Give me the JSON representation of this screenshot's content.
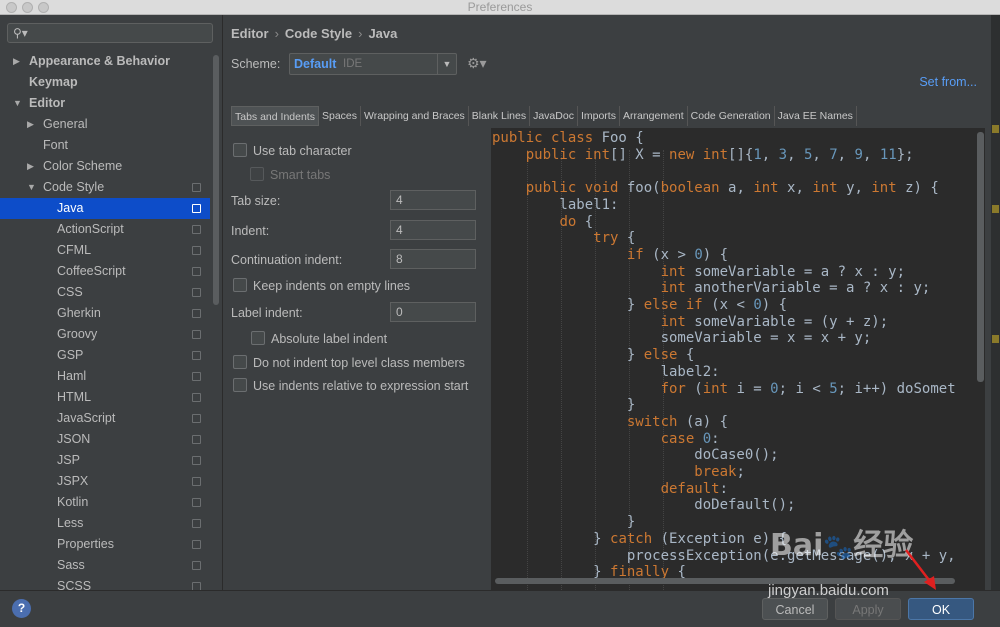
{
  "window": {
    "title": "Preferences"
  },
  "search": {
    "placeholder": ""
  },
  "sidebar": {
    "items": [
      {
        "label": "Appearance & Behavior",
        "level": 0,
        "bold": true,
        "arrow": "▶"
      },
      {
        "label": "Keymap",
        "level": 0,
        "bold": true,
        "arrow": ""
      },
      {
        "label": "Editor",
        "level": 0,
        "bold": true,
        "arrow": "▼"
      },
      {
        "label": "General",
        "level": 1,
        "arrow": "▶"
      },
      {
        "label": "Font",
        "level": 1,
        "arrow": ""
      },
      {
        "label": "Color Scheme",
        "level": 1,
        "arrow": "▶"
      },
      {
        "label": "Code Style",
        "level": 1,
        "arrow": "▼",
        "copy": true
      },
      {
        "label": "Java",
        "level": 2,
        "selected": true,
        "copy": true
      },
      {
        "label": "ActionScript",
        "level": 2,
        "copy": true
      },
      {
        "label": "CFML",
        "level": 2,
        "copy": true
      },
      {
        "label": "CoffeeScript",
        "level": 2,
        "copy": true
      },
      {
        "label": "CSS",
        "level": 2,
        "copy": true
      },
      {
        "label": "Gherkin",
        "level": 2,
        "copy": true
      },
      {
        "label": "Groovy",
        "level": 2,
        "copy": true
      },
      {
        "label": "GSP",
        "level": 2,
        "copy": true
      },
      {
        "label": "Haml",
        "level": 2,
        "copy": true
      },
      {
        "label": "HTML",
        "level": 2,
        "copy": true
      },
      {
        "label": "JavaScript",
        "level": 2,
        "copy": true
      },
      {
        "label": "JSON",
        "level": 2,
        "copy": true
      },
      {
        "label": "JSP",
        "level": 2,
        "copy": true
      },
      {
        "label": "JSPX",
        "level": 2,
        "copy": true
      },
      {
        "label": "Kotlin",
        "level": 2,
        "copy": true
      },
      {
        "label": "Less",
        "level": 2,
        "copy": true
      },
      {
        "label": "Properties",
        "level": 2,
        "copy": true
      },
      {
        "label": "Sass",
        "level": 2,
        "copy": true
      },
      {
        "label": "SCSS",
        "level": 2,
        "copy": true
      }
    ]
  },
  "breadcrumb": [
    "Editor",
    "Code Style",
    "Java"
  ],
  "scheme": {
    "label": "Scheme:",
    "value": "Default",
    "sub": "IDE"
  },
  "set_from": "Set from...",
  "tabs": [
    "Tabs and Indents",
    "Spaces",
    "Wrapping and Braces",
    "Blank Lines",
    "JavaDoc",
    "Imports",
    "Arrangement",
    "Code Generation",
    "Java EE Names"
  ],
  "options": {
    "use_tab_character": "Use tab character",
    "smart_tabs": "Smart tabs",
    "tab_size_label": "Tab size:",
    "tab_size": "4",
    "indent_label": "Indent:",
    "indent": "4",
    "continuation_label": "Continuation indent:",
    "continuation": "8",
    "keep_indents": "Keep indents on empty lines",
    "label_indent_label": "Label indent:",
    "label_indent": "0",
    "absolute_label": "Absolute label indent",
    "no_indent_top": "Do not indent top level class members",
    "relative_indents": "Use indents relative to expression start"
  },
  "code_lines": [
    [
      [
        "kw",
        "public class "
      ],
      [
        "t",
        "Foo {"
      ]
    ],
    [
      [
        "t",
        "    "
      ],
      [
        "kw",
        "public int"
      ],
      [
        "t",
        "[] X = "
      ],
      [
        "kw",
        "new int"
      ],
      [
        "t",
        "[]{"
      ],
      [
        "n",
        "1"
      ],
      [
        "t",
        ", "
      ],
      [
        "n",
        "3"
      ],
      [
        "t",
        ", "
      ],
      [
        "n",
        "5"
      ],
      [
        "t",
        ", "
      ],
      [
        "n",
        "7"
      ],
      [
        "t",
        ", "
      ],
      [
        "n",
        "9"
      ],
      [
        "t",
        ", "
      ],
      [
        "n",
        "11"
      ],
      [
        "t",
        "};"
      ]
    ],
    [
      [
        "t",
        ""
      ]
    ],
    [
      [
        "t",
        "    "
      ],
      [
        "kw",
        "public void "
      ],
      [
        "t",
        "foo("
      ],
      [
        "kw",
        "boolean "
      ],
      [
        "t",
        "a, "
      ],
      [
        "kw",
        "int "
      ],
      [
        "t",
        "x, "
      ],
      [
        "kw",
        "int "
      ],
      [
        "t",
        "y, "
      ],
      [
        "kw",
        "int "
      ],
      [
        "t",
        "z) {"
      ]
    ],
    [
      [
        "t",
        "        label1:"
      ]
    ],
    [
      [
        "t",
        "        "
      ],
      [
        "kw",
        "do "
      ],
      [
        "t",
        "{"
      ]
    ],
    [
      [
        "t",
        "            "
      ],
      [
        "kw",
        "try "
      ],
      [
        "t",
        "{"
      ]
    ],
    [
      [
        "t",
        "                "
      ],
      [
        "kw",
        "if "
      ],
      [
        "t",
        "(x > "
      ],
      [
        "n",
        "0"
      ],
      [
        "t",
        ") {"
      ]
    ],
    [
      [
        "t",
        "                    "
      ],
      [
        "kw",
        "int "
      ],
      [
        "t",
        "someVariable = a ? x : y;"
      ]
    ],
    [
      [
        "t",
        "                    "
      ],
      [
        "kw",
        "int "
      ],
      [
        "t",
        "anotherVariable = a ? x : y;"
      ]
    ],
    [
      [
        "t",
        "                } "
      ],
      [
        "kw",
        "else if "
      ],
      [
        "t",
        "(x < "
      ],
      [
        "n",
        "0"
      ],
      [
        "t",
        ") {"
      ]
    ],
    [
      [
        "t",
        "                    "
      ],
      [
        "kw",
        "int "
      ],
      [
        "t",
        "someVariable = (y + z);"
      ]
    ],
    [
      [
        "t",
        "                    someVariable = x = x + y;"
      ]
    ],
    [
      [
        "t",
        "                } "
      ],
      [
        "kw",
        "else "
      ],
      [
        "t",
        "{"
      ]
    ],
    [
      [
        "t",
        "                    label2:"
      ]
    ],
    [
      [
        "t",
        "                    "
      ],
      [
        "kw",
        "for "
      ],
      [
        "t",
        "("
      ],
      [
        "kw",
        "int "
      ],
      [
        "t",
        "i = "
      ],
      [
        "n",
        "0"
      ],
      [
        "t",
        "; i < "
      ],
      [
        "n",
        "5"
      ],
      [
        "t",
        "; i++) doSomet"
      ]
    ],
    [
      [
        "t",
        "                }"
      ]
    ],
    [
      [
        "t",
        "                "
      ],
      [
        "kw",
        "switch "
      ],
      [
        "t",
        "(a) {"
      ]
    ],
    [
      [
        "t",
        "                    "
      ],
      [
        "kw",
        "case "
      ],
      [
        "n",
        "0"
      ],
      [
        "t",
        ":"
      ]
    ],
    [
      [
        "t",
        "                        doCase0();"
      ]
    ],
    [
      [
        "t",
        "                        "
      ],
      [
        "kw",
        "break"
      ],
      [
        "t",
        ";"
      ]
    ],
    [
      [
        "t",
        "                    "
      ],
      [
        "kw",
        "default"
      ],
      [
        "t",
        ":"
      ]
    ],
    [
      [
        "t",
        "                        doDefault();"
      ]
    ],
    [
      [
        "t",
        "                }"
      ]
    ],
    [
      [
        "t",
        "            } "
      ],
      [
        "kw",
        "catch "
      ],
      [
        "t",
        "(Exception e) {"
      ]
    ],
    [
      [
        "t",
        "                processException(e.getMessage(), x + y,"
      ]
    ],
    [
      [
        "t",
        "            } "
      ],
      [
        "kw",
        "finally "
      ],
      [
        "t",
        "{"
      ]
    ]
  ],
  "buttons": {
    "help": "?",
    "cancel": "Cancel",
    "apply": "Apply",
    "ok": "OK"
  },
  "watermark": {
    "logo": "Bai 经验",
    "url": "jingyan.baidu.com"
  },
  "colors": {
    "accent": "#589df6",
    "selection": "#0d4dc9",
    "keyword": "#cc7832",
    "number": "#6897bb"
  }
}
